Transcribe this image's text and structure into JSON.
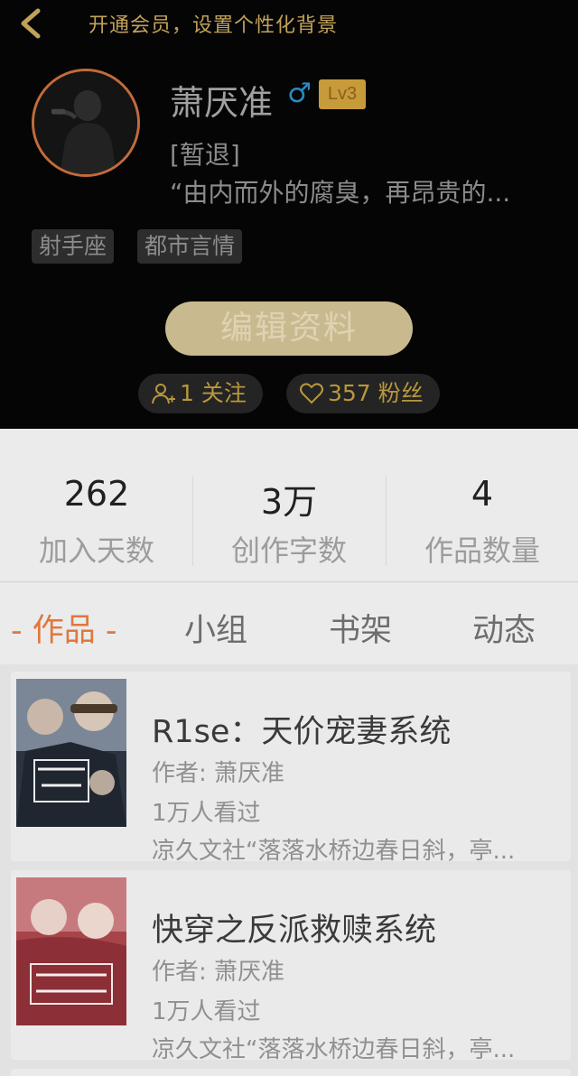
{
  "header": {
    "vip_banner": "开通会员，设置个性化背景",
    "username": "萧厌准",
    "gender_symbol": "♂",
    "level": "Lv3",
    "bio_line1": "[暂退]",
    "bio_line2": "“由内而外的腐臭，再昂贵的...",
    "tags": [
      "射手座",
      "都市言情"
    ],
    "edit_button": "编辑资料",
    "follow_label": "1 关注",
    "fans_label": "357 粉丝"
  },
  "stats": [
    {
      "value": "262",
      "label": "加入天数"
    },
    {
      "value": "3万",
      "label": "创作字数"
    },
    {
      "value": "4",
      "label": "作品数量"
    }
  ],
  "tabs": [
    "- 作品 -",
    "小组",
    "书架",
    "动态"
  ],
  "books": [
    {
      "title": "R1se：天价宠妻系统",
      "author": "作者: 萧厌准",
      "views": "1万人看过",
      "desc": "凉久文社“落落水桥边春日斜，亭..."
    },
    {
      "title": "快穿之反派救赎系统",
      "author": "作者: 萧厌准",
      "views": "1万人看过",
      "desc": "凉久文社“落落水桥边春日斜，亭..."
    }
  ],
  "colors": {
    "accent_orange": "#e0773c",
    "gold": "#b8973d",
    "gender_blue": "#2a8bc4"
  }
}
